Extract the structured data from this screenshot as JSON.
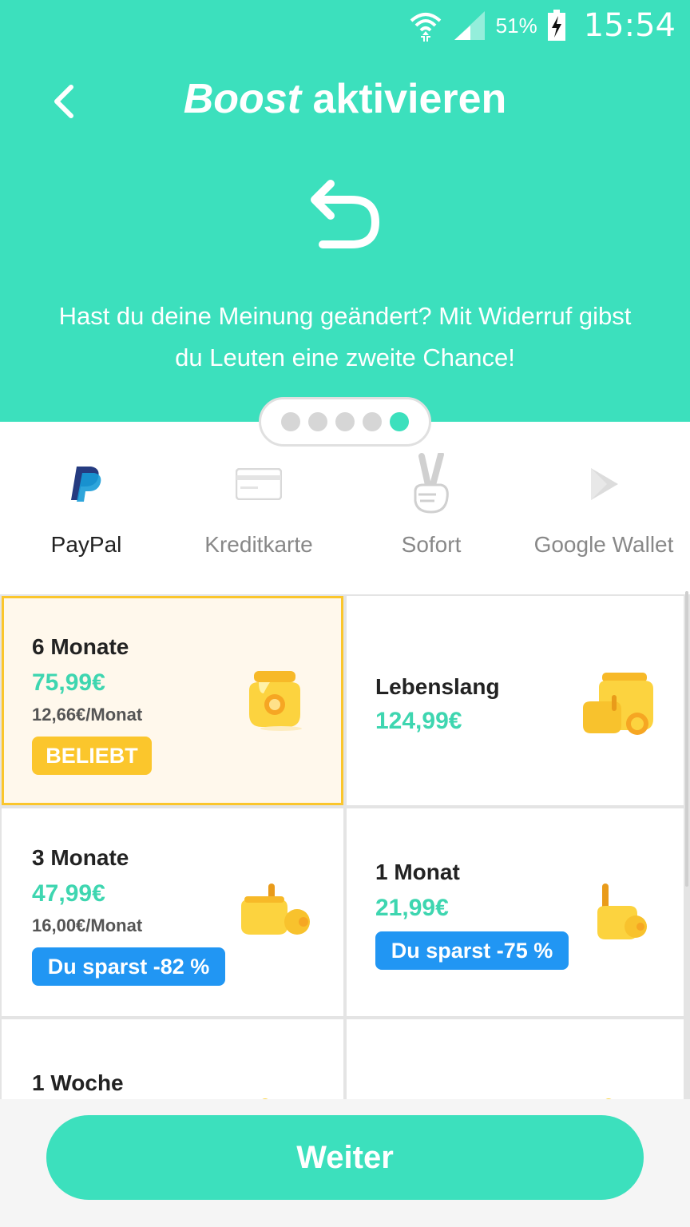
{
  "status_bar": {
    "battery_percent": "51%",
    "time": "15:54"
  },
  "header": {
    "title_emphasis": "Boost",
    "title_rest": "aktivieren",
    "description": "Hast du deine Meinung geändert? Mit Widerruf gibst du Leuten eine zweite Chance!",
    "pager": {
      "count": 5,
      "active_index": 4
    }
  },
  "payment_methods": [
    {
      "label": "PayPal",
      "icon": "paypal-icon",
      "active": true
    },
    {
      "label": "Kreditkarte",
      "icon": "credit-card-icon",
      "active": false
    },
    {
      "label": "Sofort",
      "icon": "victory-hand-icon",
      "active": false
    },
    {
      "label": "Google Wallet",
      "icon": "play-store-icon",
      "active": false
    }
  ],
  "plans": [
    {
      "name": "6 Monate",
      "price": "75,99€",
      "per_month": "12,66€/Monat",
      "badge": "BELIEBT",
      "badge_color": "#fbc62c",
      "selected": true,
      "icon": "honey-jar-icon"
    },
    {
      "name": "Lebenslang",
      "price": "124,99€",
      "icon": "honey-jars-stack-icon"
    },
    {
      "name": "3 Monate",
      "price": "47,99€",
      "per_month": "16,00€/Monat",
      "badge": "Du sparst -82 %",
      "badge_color": "#2196f3",
      "icon": "honey-pots-icon"
    },
    {
      "name": "1 Monat",
      "price": "21,99€",
      "badge": "Du sparst -75 %",
      "badge_color": "#2196f3",
      "icon": "honey-pot-dipper-icon"
    },
    {
      "name": "1 Woche",
      "icon": "honey-icon"
    }
  ],
  "continue_button": {
    "label": "Weiter"
  },
  "colors": {
    "accent": "#3ce0bd",
    "price": "#3ed6b0",
    "highlight": "#fbc62c",
    "badge_blue": "#2196f3"
  }
}
